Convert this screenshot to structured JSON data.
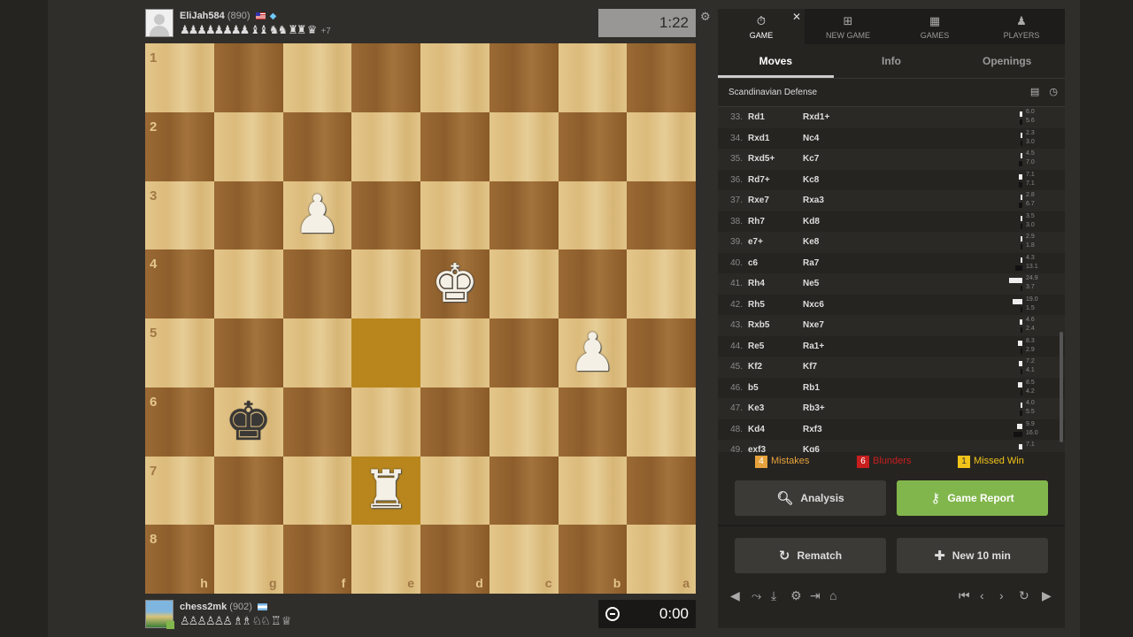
{
  "top_player": {
    "name": "EliJah584",
    "rating": "(890)",
    "captured": "♟♟♟♟♟♟♟♟ ♝♝ ♞♞ ♜♜ ♛",
    "plus": "+7",
    "clock": "1:22"
  },
  "bottom_player": {
    "name": "chess2mk",
    "rating": "(902)",
    "captured": "♙♙♙♙♙♙ ♗♗ ♘♘ ♖ ♕",
    "clock": "0:00"
  },
  "board": {
    "ranks": [
      "1",
      "2",
      "3",
      "4",
      "5",
      "6",
      "7",
      "8"
    ],
    "files": [
      "h",
      "g",
      "f",
      "e",
      "d",
      "c",
      "b",
      "a"
    ],
    "pieces": [
      {
        "square": "f3",
        "glyph": "♟",
        "color": "white"
      },
      {
        "square": "d4",
        "glyph": "♚",
        "color": "white"
      },
      {
        "square": "b5",
        "glyph": "♟",
        "color": "white"
      },
      {
        "square": "g6",
        "glyph": "♚",
        "color": "black"
      },
      {
        "square": "e7",
        "glyph": "♜",
        "color": "white"
      }
    ],
    "highlights": [
      "e5",
      "e7"
    ]
  },
  "nav": {
    "game": "GAME",
    "new_game": "NEW GAME",
    "games": "GAMES",
    "players": "PLAYERS"
  },
  "tabs": {
    "moves": "Moves",
    "info": "Info",
    "openings": "Openings"
  },
  "opening_name": "Scandinavian Defense",
  "moves": [
    {
      "num": "33.",
      "w": "Rd1",
      "b": "Rxd1+",
      "e1": "6.0",
      "e2": "5.6",
      "v1": 0.05,
      "v2": 0.05
    },
    {
      "num": "34.",
      "w": "Rxd1",
      "b": "Nc4",
      "e1": "2.3",
      "e2": "3.0",
      "v1": 0.02,
      "v2": 0.03
    },
    {
      "num": "35.",
      "w": "Rxd5+",
      "b": "Kc7",
      "e1": "4.5",
      "e2": "7.0",
      "v1": 0.04,
      "v2": 0.07
    },
    {
      "num": "36.",
      "w": "Rd7+",
      "b": "Kc8",
      "e1": "7.1",
      "e2": "7.1",
      "v1": 0.07,
      "v2": 0.07
    },
    {
      "num": "37.",
      "w": "Rxe7",
      "b": "Rxa3",
      "e1": "2.8",
      "e2": "6.7",
      "v1": 0.03,
      "v2": 0.06
    },
    {
      "num": "38.",
      "w": "Rh7",
      "b": "Kd8",
      "e1": "3.5",
      "e2": "3.0",
      "v1": 0.03,
      "v2": 0.03
    },
    {
      "num": "39.",
      "w": "e7+",
      "b": "Ke8",
      "e1": "2.9",
      "e2": "1.8",
      "v1": 0.03,
      "v2": 0.02
    },
    {
      "num": "40.",
      "w": "c6",
      "b": "Ra7",
      "e1": "4.3",
      "e2": "13.1",
      "v1": 0.04,
      "v2": 0.13
    },
    {
      "num": "41.",
      "w": "Rh4",
      "b": "Ne5",
      "e1": "24.9",
      "e2": "3.7",
      "v1": 0.25,
      "v2": 0.04
    },
    {
      "num": "42.",
      "w": "Rh5",
      "b": "Nxc6",
      "e1": "19.0",
      "e2": "1.5",
      "v1": 0.19,
      "v2": 0.02
    },
    {
      "num": "43.",
      "w": "Rxb5",
      "b": "Nxe7",
      "e1": "4.6",
      "e2": "2.4",
      "v1": 0.05,
      "v2": 0.02
    },
    {
      "num": "44.",
      "w": "Re5",
      "b": "Ra1+",
      "e1": "8.3",
      "e2": "2.9",
      "v1": 0.08,
      "v2": 0.03
    },
    {
      "num": "45.",
      "w": "Kf2",
      "b": "Kf7",
      "e1": "7.2",
      "e2": "4.1",
      "v1": 0.07,
      "v2": 0.04
    },
    {
      "num": "46.",
      "w": "b5",
      "b": "Rb1",
      "e1": "8.5",
      "e2": "4.2",
      "v1": 0.08,
      "v2": 0.04
    },
    {
      "num": "47.",
      "w": "Ke3",
      "b": "Rb3+",
      "e1": "4.0",
      "e2": "5.5",
      "v1": 0.04,
      "v2": 0.05
    },
    {
      "num": "48.",
      "w": "Kd4",
      "b": "Rxf3",
      "e1": "9.9",
      "e2": "16.0",
      "v1": 0.1,
      "v2": 0.16
    },
    {
      "num": "49.",
      "w": "exf3",
      "b": "Kg6",
      "e1": "7.1",
      "e2": "",
      "v1": 0.07,
      "v2": 0.0
    }
  ],
  "summary": {
    "mistakes_count": "4",
    "mistakes_label": "Mistakes",
    "blunders_count": "6",
    "blunders_label": "Blunders",
    "missed_count": "1",
    "missed_label": "Missed Win"
  },
  "buttons": {
    "analysis": "Analysis",
    "game_report": "Game Report",
    "rematch": "Rematch",
    "new_game": "New 10 min"
  },
  "colors": {
    "report_green": "#81b64c",
    "mistake": "#e6a23c",
    "blunder": "#c81e1e",
    "missed": "#f0c419"
  }
}
